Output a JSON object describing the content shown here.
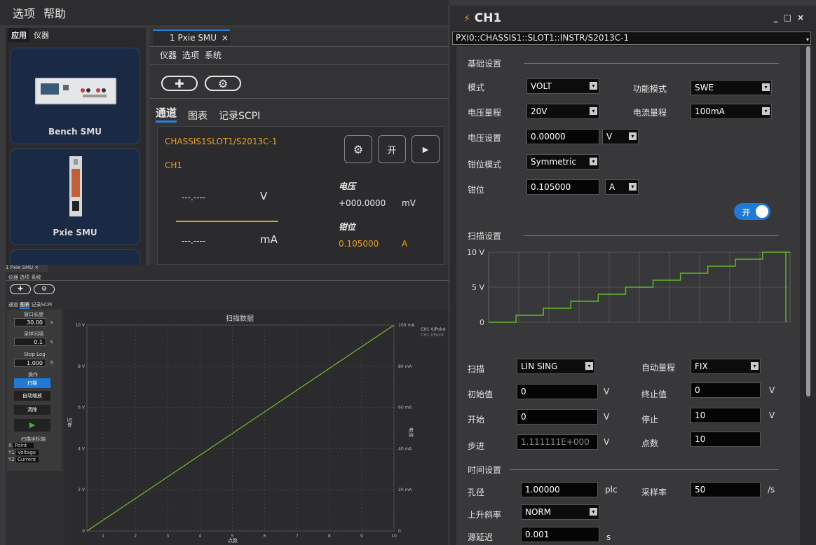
{
  "menubar": {
    "items": [
      "选项",
      "帮助"
    ]
  },
  "left_panel": {
    "tabs": [
      "应用",
      "仪器"
    ],
    "cards": [
      "Bench SMU",
      "Pxie SMU"
    ]
  },
  "center": {
    "doc_tab": "1 Pxie SMU",
    "doc_tab_close": "×",
    "submenu": [
      "仪器",
      "选项",
      "系统"
    ],
    "tabs": [
      "通道",
      "图表",
      "记录SCPI"
    ],
    "channel": {
      "resource": "CHASSIS1SLOT1/S2013C-1",
      "name": "CH1",
      "on_label": "开",
      "left_v_reading": "---.----",
      "left_v_unit": "V",
      "left_a_reading": "---.----",
      "left_a_unit": "mA",
      "voltage_label": "电压",
      "voltage_value": "+000.0000",
      "voltage_unit": "mV",
      "clamp_label": "钳位",
      "clamp_value": "0.105000",
      "clamp_unit": "A"
    }
  },
  "mini": {
    "tab": "1 Pxie SMU ×",
    "submenu": [
      "仪器",
      "选项",
      "系统"
    ],
    "tabs": [
      "通道",
      "图表",
      "记录SCPI"
    ],
    "window_length_label": "窗口长度",
    "window_length": "30.00",
    "window_length_unit": "s",
    "sample_interval_label": "采样间隔",
    "sample_interval": "0.1",
    "sample_interval_unit": "s",
    "stop_log_label": "Stop Log",
    "stop_log": "1.000",
    "stop_log_unit": "h",
    "ops_label": "操作",
    "buttons": [
      "扫描",
      "自动缩放",
      "清除"
    ],
    "axis_setting_label": "扫描坐标轴",
    "axes": [
      {
        "axis": "X",
        "value": "Point"
      },
      {
        "axis": "Y1",
        "value": "Voltage"
      },
      {
        "axis": "Y2",
        "value": "Current"
      }
    ],
    "chart_title": "扫描数据",
    "legend": [
      "CH1 V/Point",
      "CH1 I/Point"
    ],
    "xlabel": "点数",
    "ylabel_left": "电压",
    "ylabel_right": "电流",
    "chart_data": {
      "type": "line",
      "title": "扫描数据",
      "xlabel": "点数",
      "x_ticks": [
        1,
        2,
        3,
        4,
        5,
        6,
        7,
        8,
        9,
        10
      ],
      "y1_ticks": [
        "0",
        "2 V",
        "4 V",
        "6 V",
        "8 V",
        "10 V"
      ],
      "y2_ticks": [
        "0",
        "20 mA",
        "40 mA",
        "60 mA",
        "80 mA",
        "100 mA"
      ],
      "xlim": [
        0.5,
        10
      ],
      "ylim": [
        0,
        10
      ],
      "series": [
        {
          "name": "CH1 V/Point",
          "x": [
            0.5,
            10
          ],
          "y": [
            0,
            10
          ],
          "color": "#7ab834"
        }
      ]
    }
  },
  "ch1": {
    "title": "CH1",
    "controls": [
      "_",
      "□",
      "×"
    ],
    "address": "PXI0::CHASSIS1::SLOT1::INSTR/S2013C-1",
    "basic_settings": "基础设置",
    "mode_label": "模式",
    "mode": "VOLT",
    "function_label": "功能模式",
    "function": "SWE",
    "vrange_label": "电压量程",
    "vrange": "20V",
    "irange_label": "电流量程",
    "irange": "100mA",
    "vset_label": "电压设置",
    "vset": "0.00000",
    "vset_unit": "V",
    "clamp_mode_label": "钳位模式",
    "clamp_mode": "Symmetric",
    "clamp_label": "钳位",
    "clamp": "0.105000",
    "clamp_unit": "A",
    "toggle_label": "开",
    "sweep_settings": "扫描设置",
    "sweep_chart": {
      "type": "line",
      "y_ticks": [
        "0",
        "5 V",
        "10 V"
      ],
      "ylim": [
        0,
        10
      ],
      "steps": [
        0,
        1,
        2,
        3,
        4,
        5,
        6,
        7,
        8,
        9,
        10
      ],
      "color": "#5fb62a"
    },
    "sweep_label": "扫描",
    "sweep": "LIN SING",
    "autorange_label": "自动量程",
    "autorange": "FIX",
    "initial_label": "初始值",
    "initial": "0",
    "initial_unit": "V",
    "final_label": "终止值",
    "final": "0",
    "final_unit": "V",
    "start_label": "开始",
    "start": "0",
    "start_unit": "V",
    "stop_label": "停止",
    "stop": "10",
    "stop_unit": "V",
    "step_label": "步进",
    "step": "1.111111E+000",
    "step_unit": "V",
    "points_label": "点数",
    "points": "10",
    "time_settings": "时间设置",
    "aperture_label": "孔径",
    "aperture": "1.00000",
    "aperture_unit": "plc",
    "sample_rate_label": "采样率",
    "sample_rate": "50",
    "sample_rate_unit": "/s",
    "slew_label": "上升斜率",
    "slew": "NORM",
    "delay_label": "源延迟",
    "delay": "0.001",
    "delay_unit": "s"
  }
}
